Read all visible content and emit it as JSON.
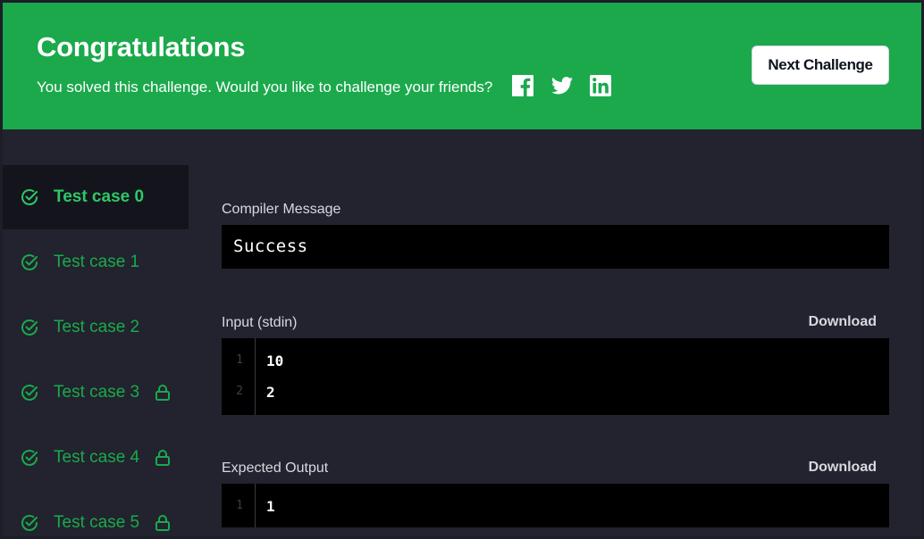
{
  "banner": {
    "title": "Congratulations",
    "subtitle": "You solved this challenge. Would you like to challenge your friends?",
    "share_icons": [
      "facebook-icon",
      "twitter-icon",
      "linkedin-icon"
    ],
    "next_button": "Next Challenge",
    "background_color": "#1ba94c"
  },
  "sidebar": {
    "items": [
      {
        "label": "Test case 0",
        "status": "passed",
        "locked": false,
        "active": true
      },
      {
        "label": "Test case 1",
        "status": "passed",
        "locked": false,
        "active": false
      },
      {
        "label": "Test case 2",
        "status": "passed",
        "locked": false,
        "active": false
      },
      {
        "label": "Test case 3",
        "status": "passed",
        "locked": true,
        "active": false
      },
      {
        "label": "Test case 4",
        "status": "passed",
        "locked": true,
        "active": false
      },
      {
        "label": "Test case 5",
        "status": "passed",
        "locked": true,
        "active": false
      }
    ]
  },
  "main": {
    "compiler": {
      "label": "Compiler Message",
      "message": "Success"
    },
    "input": {
      "label": "Input (stdin)",
      "download": "Download",
      "lines": [
        {
          "no": "1",
          "text": "10"
        },
        {
          "no": "2",
          "text": "2"
        }
      ]
    },
    "expected": {
      "label": "Expected Output",
      "download": "Download",
      "lines": [
        {
          "no": "1",
          "text": "1"
        }
      ]
    }
  },
  "colors": {
    "accent_green": "#1ba94c",
    "active_label_green": "#2ec866",
    "page_background": "#22232e",
    "code_background": "#000000"
  }
}
